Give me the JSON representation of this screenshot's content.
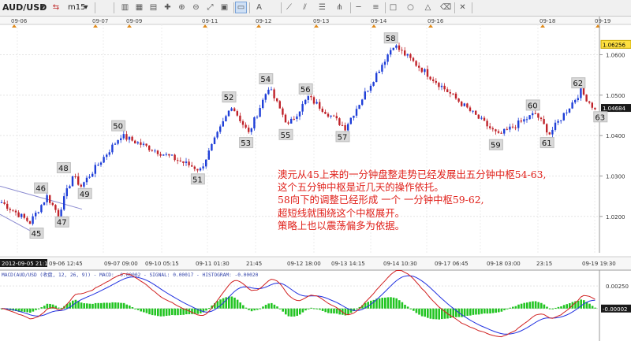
{
  "toolbar": {
    "symbol": "AUD/USD",
    "timeframe": "m15",
    "icons": [
      "bar-chart-icon",
      "candlestick-icon",
      "line-chart-icon",
      "crosshair-icon",
      "zoom-in-icon",
      "zoom-out-icon",
      "fit-icon",
      "template-icon",
      "cursor-icon",
      "text-icon",
      "trend-line-icon",
      "channel-icon",
      "fibonacci-icon",
      "pitchfork-icon",
      "horizontal-line-icon",
      "indicator-icon",
      "rectangle-icon",
      "ellipse-icon",
      "triangle-icon",
      "eraser-icon",
      "delete-icon"
    ]
  },
  "top_dates": [
    "09-06",
    "09-07",
    "09-09",
    "09-11",
    "09-12",
    "09-13",
    "09-14",
    "09-16",
    "09-18",
    "09-19"
  ],
  "bottom_timeline": {
    "cursor_label": "2012-09-05 21:15",
    "labels": [
      "09-06 12:45",
      "09-07 09:00",
      "09-10 05:15",
      "09-11 01:30",
      "21:45",
      "09-12 18:00",
      "09-13 14:15",
      "09-14 10:30",
      "09-17 06:45",
      "09-18 03:00",
      "23:15",
      "09-19 19:30"
    ]
  },
  "indicator": {
    "header": "MACD(AUD/USD (收盘, 12, 26, 9))  -  MACD: -0.00002  -  SIGNAL: 0.00017  -  HISTOGRAM: -0.00020"
  },
  "annotation_lines": [
    "澳元从45上来的一分钟盘整走势已经发展出五分钟中枢54-63,",
    "这个五分钟中枢是近几天的操作依托。",
    "58向下的调整已经形成  一个   一分钟中枢59-62,",
    "超短线就围绕这个中枢展开。",
    "策略上也以震荡偏多为依据。"
  ],
  "colors": {
    "up": "#1f3fd8",
    "down": "#c0232a",
    "macd": "#d02020",
    "signal": "#2030e0",
    "histogram": "#22c422",
    "annotation": "#e0201a"
  },
  "chart_data": {
    "type": "candlestick",
    "title": "AUD/USD m15",
    "y_ticks": [
      1.02,
      1.03,
      1.04,
      1.05,
      1.06
    ],
    "y_current": 1.04684,
    "y_high_label": 1.06256,
    "ylim": [
      1.011,
      1.0675
    ],
    "waypoints": [
      {
        "label": "",
        "x": 0.5,
        "y": 1.0235
      },
      {
        "label": "45",
        "x": 10,
        "y": 1.0185
      },
      {
        "label": "46",
        "x": 16,
        "y": 1.025
      },
      {
        "label": "47",
        "x": 19.5,
        "y": 1.0205
      },
      {
        "label": "48",
        "x": 24,
        "y": 1.03
      },
      {
        "label": "49",
        "x": 27,
        "y": 1.0275
      },
      {
        "label": "50",
        "x": 41,
        "y": 1.04
      },
      {
        "label": "51",
        "x": 69,
        "y": 1.0315
      },
      {
        "label": "52",
        "x": 80,
        "y": 1.0475
      },
      {
        "label": "53",
        "x": 86,
        "y": 1.0405
      },
      {
        "label": "54",
        "x": 93,
        "y": 1.052
      },
      {
        "label": "55",
        "x": 100,
        "y": 1.0425
      },
      {
        "label": "56",
        "x": 107,
        "y": 1.0495
      },
      {
        "label": "57",
        "x": 120,
        "y": 1.042
      },
      {
        "label": "58",
        "x": 137,
        "y": 1.0625
      },
      {
        "label": "59",
        "x": 174,
        "y": 1.04
      },
      {
        "label": "60",
        "x": 187,
        "y": 1.0455
      },
      {
        "label": "61",
        "x": 192,
        "y": 1.0405
      },
      {
        "label": "62",
        "x": 203,
        "y": 1.051
      },
      {
        "label": "63",
        "x": 208,
        "y": 1.0465
      }
    ],
    "point_labels": [
      "45",
      "46",
      "47",
      "48",
      "49",
      "50",
      "51",
      "52",
      "53",
      "54",
      "55",
      "56",
      "57",
      "58",
      "59",
      "60",
      "61",
      "62",
      "63"
    ],
    "macd_ticks": [
      0.0025,
      0.0
    ],
    "macd_current": -2e-05,
    "macd_ylim": [
      -0.0036,
      0.0033
    ]
  }
}
